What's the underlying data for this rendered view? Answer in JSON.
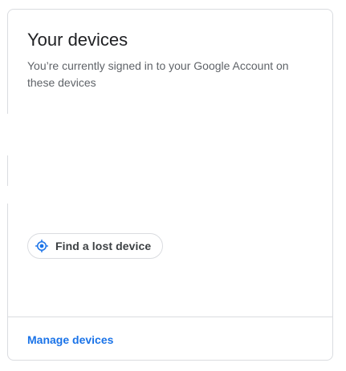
{
  "card": {
    "title": "Your devices",
    "description": "You’re currently signed in to your Google Account on these devices",
    "find_device": {
      "label": "Find a lost device",
      "icon": "locate-icon"
    },
    "footer": {
      "link_label": "Manage devices"
    }
  },
  "colors": {
    "link": "#1a73e8",
    "border": "#dadce0",
    "title": "#202124",
    "secondary_text": "#5f6368"
  }
}
